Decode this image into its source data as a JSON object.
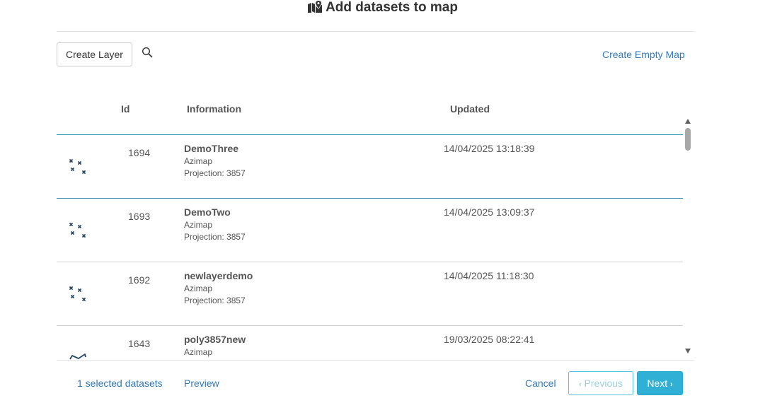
{
  "dialog": {
    "title": "Add datasets to map",
    "title_icon": "map-marker-icon"
  },
  "toolbar": {
    "create_layer_label": "Create Layer",
    "search_icon": "search-icon",
    "create_empty_map_label": "Create Empty Map"
  },
  "table": {
    "headers": {
      "id": "Id",
      "information": "Information",
      "updated": "Updated"
    },
    "rows": [
      {
        "icon": "point-layer-icon",
        "id": "1694",
        "name": "DemoThree",
        "source": "Azimap",
        "projection": "Projection: 3857",
        "updated": "14/04/2025 13:18:39",
        "selected": true
      },
      {
        "icon": "point-layer-icon",
        "id": "1693",
        "name": "DemoTwo",
        "source": "Azimap",
        "projection": "Projection: 3857",
        "updated": "14/04/2025 13:09:37",
        "selected": false
      },
      {
        "icon": "point-layer-icon",
        "id": "1692",
        "name": "newlayerdemo",
        "source": "Azimap",
        "projection": "Projection: 3857",
        "updated": "14/04/2025 11:18:30",
        "selected": false
      },
      {
        "icon": "polygon-layer-icon",
        "id": "1643",
        "name": "poly3857new",
        "source": "Azimap",
        "projection": "",
        "updated": "19/03/2025 08:22:41",
        "selected": false
      }
    ]
  },
  "footer": {
    "selected_count": "1 selected datasets",
    "preview_label": "Preview",
    "cancel_label": "Cancel",
    "previous_label": "Previous",
    "next_label": "Next"
  },
  "colors": {
    "link": "#337ab7",
    "info_button": "#31b0d5",
    "row_selected_border": "#3a8fb3",
    "icon_color": "#2a4a6b"
  }
}
